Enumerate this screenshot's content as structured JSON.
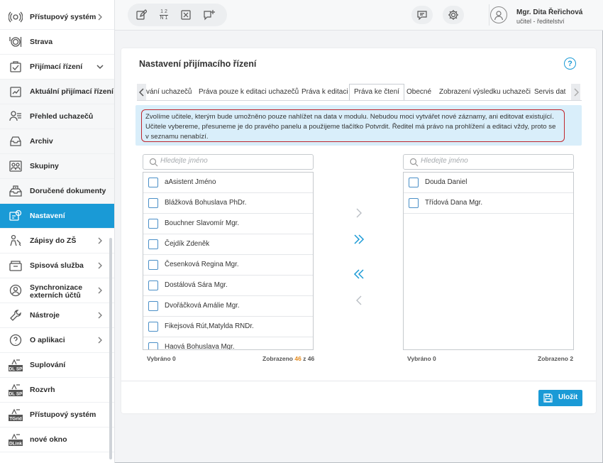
{
  "sidebar": {
    "items": [
      {
        "label": "Přístupový systém",
        "icon": "access-system-icon",
        "chevron": "right"
      },
      {
        "label": "Strava",
        "icon": "meal-icon",
        "chevron": ""
      },
      {
        "label": "Přijímací řízení",
        "icon": "admission-icon",
        "chevron": "down"
      },
      {
        "label": "Aktuální přijímací řízení",
        "icon": "current-admission-icon",
        "chevron": ""
      },
      {
        "label": "Přehled uchazečů",
        "icon": "applicants-overview-icon",
        "chevron": ""
      },
      {
        "label": "Archiv",
        "icon": "archive-icon",
        "chevron": ""
      },
      {
        "label": "Skupiny",
        "icon": "groups-icon",
        "chevron": ""
      },
      {
        "label": "Doručené dokumenty",
        "icon": "inbox-documents-icon",
        "chevron": ""
      },
      {
        "label": "Nastavení",
        "icon": "settings-icon",
        "chevron": ""
      },
      {
        "label": "Zápisy do ZŠ",
        "icon": "enrollment-icon",
        "chevron": "right"
      },
      {
        "label": "Spisová služba",
        "icon": "filing-icon",
        "chevron": "right"
      },
      {
        "label": "Synchronizace externích účtů",
        "icon": "sync-accounts-icon",
        "chevron": "right"
      },
      {
        "label": "Nástroje",
        "icon": "tools-icon",
        "chevron": "right"
      },
      {
        "label": "O aplikaci",
        "icon": "about-icon",
        "chevron": "right"
      },
      {
        "label": "Suplování",
        "icon": "substitution-icon",
        "chevron": ""
      },
      {
        "label": "Rozvrh",
        "icon": "timetable-icon",
        "chevron": ""
      },
      {
        "label": "Přístupový systém",
        "icon": "access-system-icon-2",
        "chevron": ""
      },
      {
        "label": "nové okno",
        "icon": "new-window-icon",
        "chevron": ""
      }
    ],
    "icon_texts": {
      "suplovani": "DL SP",
      "rozvrh": "DL SP",
      "pristup": "TGrid",
      "nove": "DLink"
    }
  },
  "topbar": {
    "user_name": "Mgr. Dita Řeřichová",
    "user_role": "učitel - ředitelství",
    "fraction_top": "1 2",
    "fraction_bottom": "N 1"
  },
  "panel": {
    "title": "Nastavení přijímacího řízení",
    "help": "?",
    "tabs": [
      "vání uchazečů",
      "Práva pouze k editaci uchazečů",
      "Práva k editaci",
      "Práva ke čtení",
      "Obecné",
      "Zobrazení výsledku uchazeči",
      "Servis dat"
    ],
    "info_text": "Zvolíme učitele, kterým bude umožněno pouze nahlížet na data v modulu. Nebudou moci vytvářet nové záznamy, ani editovat existující. Učitele vybereme, přesuneme je do pravého panelu a použijeme tlačítko Potvrdit. Ředitel má právo na prohlížení a editaci vždy, proto se v seznamu nenabízí.",
    "left": {
      "placeholder": "Hledejte jméno",
      "items": [
        "aAsistent Jméno",
        "Blážková Bohuslava PhDr.",
        "Bouchner Slavomír Mgr.",
        "Čejdík Zdeněk",
        "Česenková Regina Mgr.",
        "Dostálová Sára Mgr.",
        "Dvořáčková Amálie Mgr.",
        "Fikejsová Rút,Matylda RNDr.",
        "Haová Bohuslava Mgr."
      ],
      "selected": "Vybráno 0",
      "shown_prefix": "Zobrazeno ",
      "shown_count": "46",
      "shown_suffix": " z 46"
    },
    "right": {
      "placeholder": "Hledejte jméno",
      "items": [
        "Douda Daniel",
        "Třídová Dana Mgr."
      ],
      "selected": "Vybráno 0",
      "shown": "Zobrazeno 2"
    },
    "save_label": "Uložit"
  },
  "colors": {
    "accent": "#1a9ad6",
    "highlight": "#c0262d",
    "count": "#e48a1d",
    "info_bg": "#d9eefa"
  }
}
